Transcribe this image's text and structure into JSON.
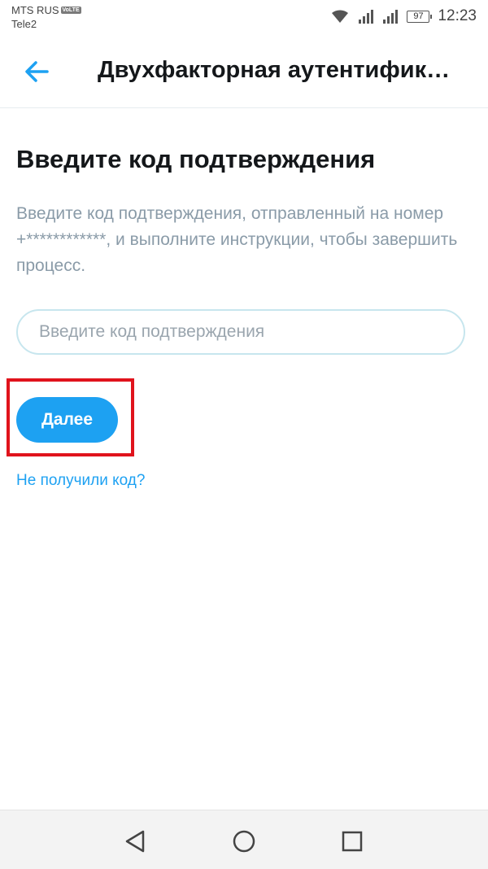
{
  "status_bar": {
    "carrier_primary": "MTS RUS",
    "volte_badge": "VoLTE",
    "carrier_secondary": "Tele2",
    "battery": "97",
    "time": "12:23"
  },
  "app_bar": {
    "title": "Двухфакторная аутентифик…",
    "back_icon": "arrow-left-icon"
  },
  "content": {
    "heading": "Введите код подтверждения",
    "description": "Введите код подтверждения, отправленный на номер +************, и выполните инструкции, чтобы завершить процесс.",
    "code_input": {
      "value": "",
      "placeholder": "Введите код подтверждения"
    },
    "next_button_label": "Далее",
    "resend_link": "Не получили код?"
  },
  "nav_bar": {
    "icons": [
      "back-triangle-icon",
      "home-circle-icon",
      "recents-square-icon"
    ]
  },
  "colors": {
    "accent": "#1da1f2",
    "highlight": "#e0131c",
    "text_primary": "#14171a",
    "text_secondary": "#8a9ba8"
  }
}
